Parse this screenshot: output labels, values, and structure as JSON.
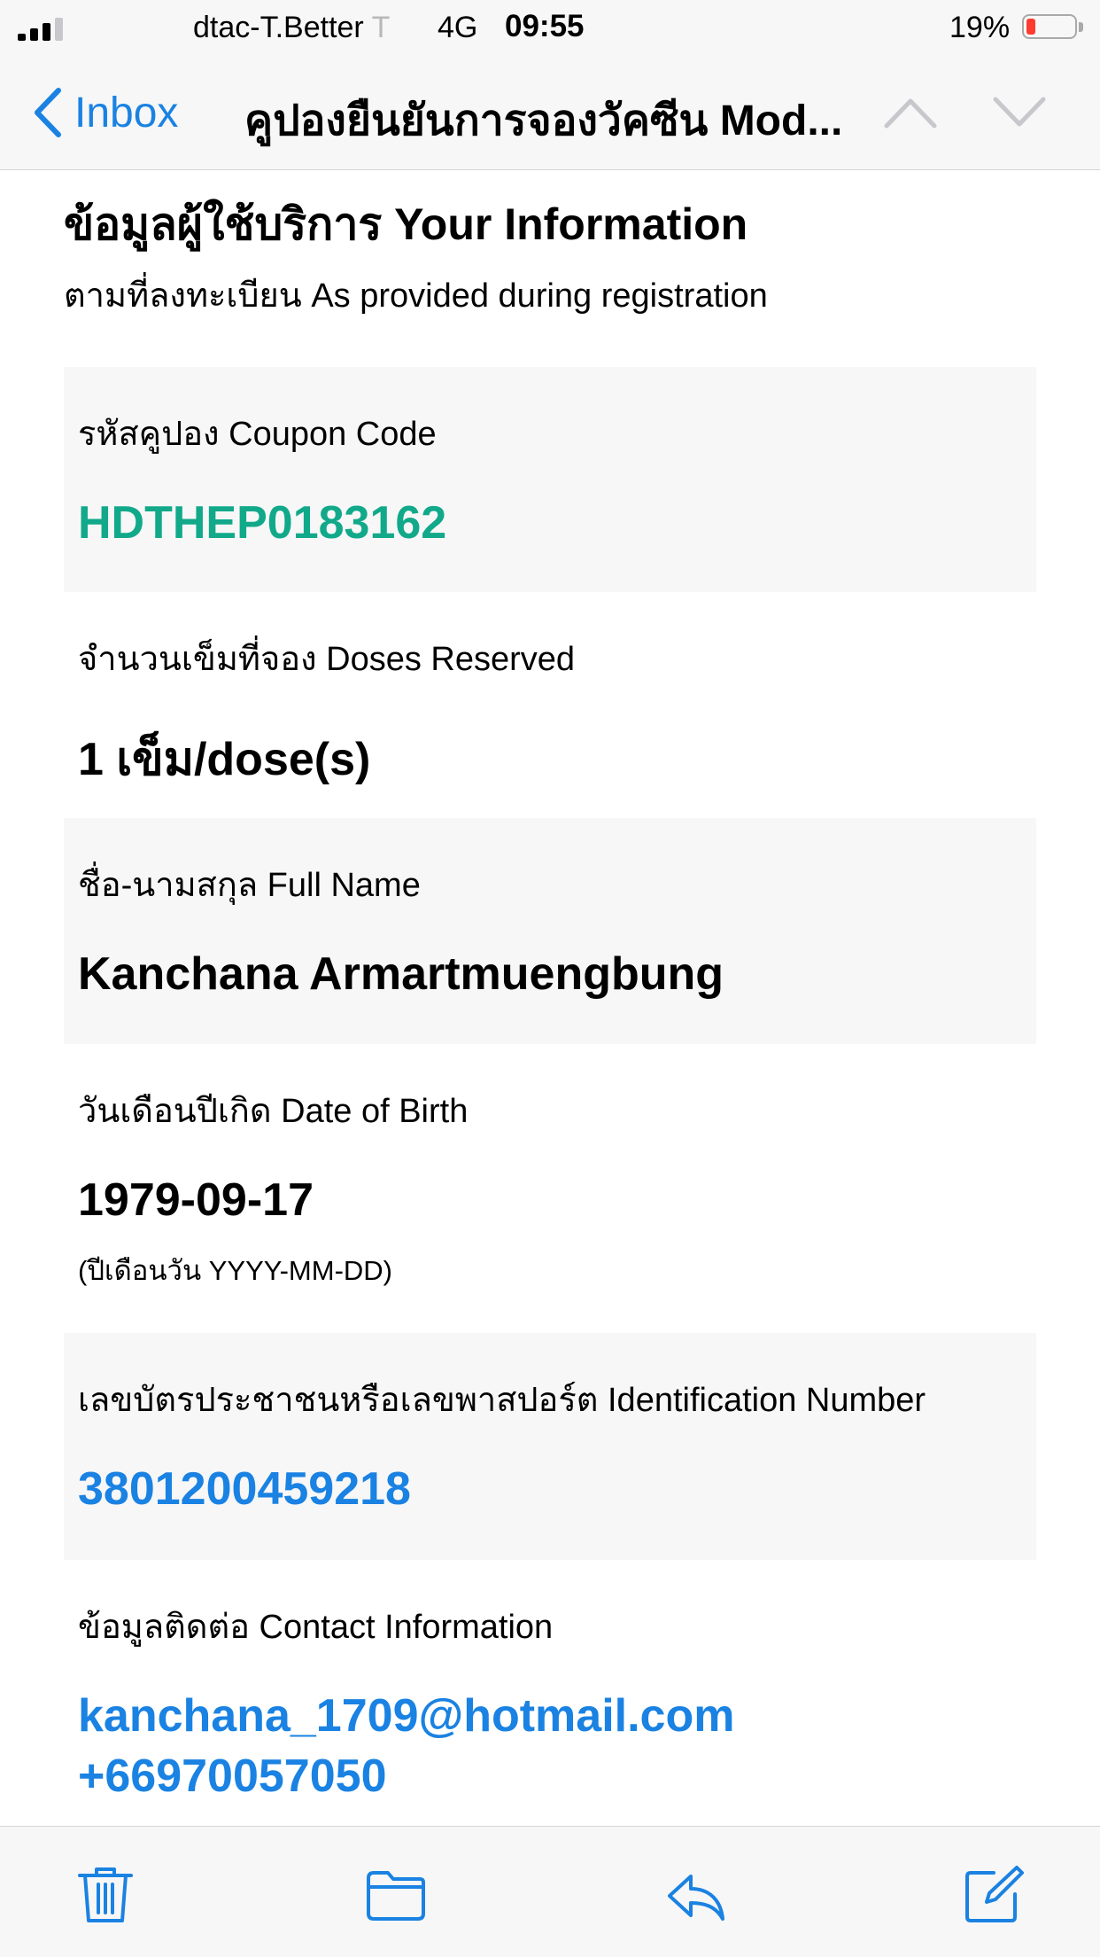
{
  "status_bar": {
    "carrier": "dtac-T.Better",
    "carrier_cut": "T",
    "network": "4G",
    "time": "09:55",
    "battery": "19%",
    "battery_level": 0.19,
    "battery_color": "#ff3b30"
  },
  "nav": {
    "back_label": "Inbox",
    "title": "คูปองยืนยันการจองวัคซีน Mod..."
  },
  "section": {
    "title": "ข้อมูลผู้ใช้บริการ Your Information",
    "subtitle": "ตามที่ลงทะเบียน  As provided during registration"
  },
  "fields": {
    "coupon": {
      "label": "รหัสคูปอง Coupon Code",
      "value": "HDTHEP0183162"
    },
    "doses": {
      "label": "จำนวนเข็มที่จอง Doses Reserved",
      "value": "1 เข็ม/dose(s)"
    },
    "name": {
      "label": "ชื่อ-นามสกุล Full Name",
      "value": "Kanchana Armartmuengbung"
    },
    "dob": {
      "label": "วันเดือนปีเกิด Date of Birth",
      "value": "1979-09-17",
      "hint": "(ปีเดือนวัน YYYY-MM-DD)"
    },
    "id": {
      "label": "เลขบัตรประชาชนหรือเลขพาสปอร์ต Identification Number",
      "value": "3801200459218"
    },
    "contact": {
      "label": "ข้อมูลติดต่อ Contact Information",
      "email": "kanchana_1709@hotmail.com",
      "phone": "+66970057050"
    }
  },
  "colors": {
    "accent_blue": "#1a82e2",
    "coupon_green": "#11a98a"
  },
  "toolbar": {
    "icons": [
      "trash-icon",
      "folder-icon",
      "reply-icon",
      "compose-icon"
    ]
  }
}
